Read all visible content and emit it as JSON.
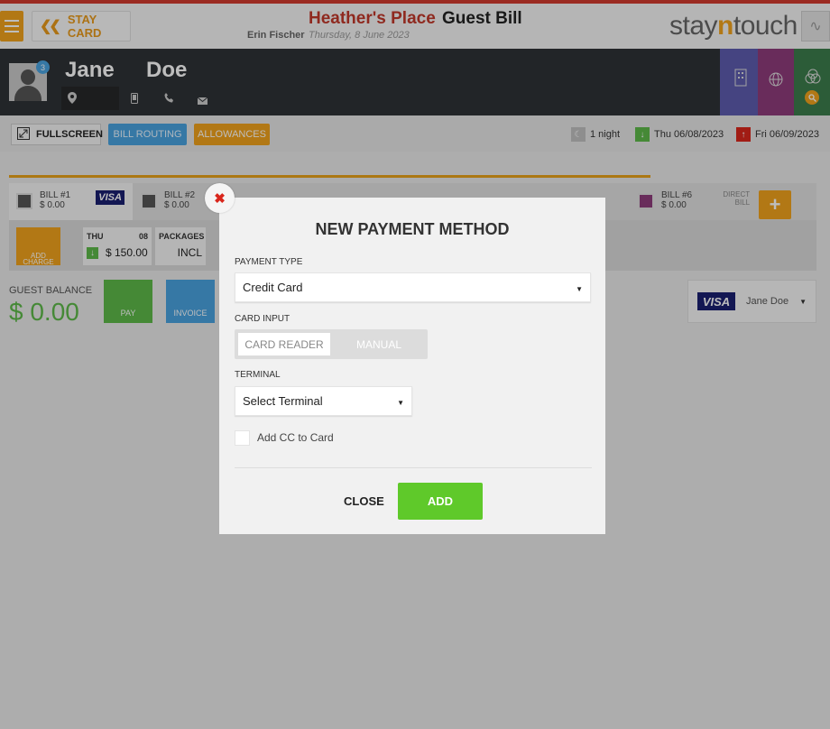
{
  "header": {
    "menu_icon": "hamburger-icon",
    "stay_card_label": "STAY CARD",
    "hotel_name": "Heather's Place",
    "page_title": "Guest Bill",
    "user_name": "Erin Fischer",
    "date": "Thursday, 8 June 2023",
    "logo_text_1": "stay",
    "logo_text_2": "n",
    "logo_text_3": "touch"
  },
  "guest": {
    "first_name": "Jane",
    "last_name": "Doe",
    "badge_count": "3"
  },
  "toolbar": {
    "fullscreen_label": "FULLSCREEN",
    "bill_routing_label": "BILL ROUTING",
    "allowances_label": "ALLOWANCES",
    "nights": "1 night",
    "arrival": "Thu 06/08/2023",
    "departure": "Fri 06/09/2023"
  },
  "bills": [
    {
      "name": "BILL #1",
      "amount": "$ 0.00",
      "card": "VISA"
    },
    {
      "name": "BILL #2",
      "amount": "$ 0.00"
    },
    {
      "name": "BILL #6",
      "amount": "$ 0.00",
      "note": "DIRECT BILL"
    }
  ],
  "charges": {
    "add_charge_label": "ADD CHARGE",
    "cards": [
      {
        "day": "THU",
        "num": "08",
        "amount": "$ 150.00"
      },
      {
        "label": "PACKAGES",
        "value": "INCL"
      }
    ]
  },
  "balance": {
    "label": "GUEST BALANCE",
    "value": "$ 0.00",
    "pay_label": "PAY",
    "invoice_label": "INVOICE",
    "card_holder": "Jane Doe"
  },
  "modal": {
    "title": "NEW PAYMENT METHOD",
    "payment_type_label": "PAYMENT TYPE",
    "payment_type_value": "Credit Card",
    "card_input_label": "CARD INPUT",
    "card_reader_label": "CARD READER",
    "manual_label": "MANUAL",
    "terminal_label": "TERMINAL",
    "terminal_value": "Select Terminal",
    "add_cc_label": "Add CC to Card",
    "close_label": "CLOSE",
    "add_label": "ADD"
  },
  "colors": {
    "accent_orange": "#f0a21d",
    "brand_red": "#c2382a",
    "add_green": "#5fc92a",
    "info_blue": "#4aa3df"
  }
}
